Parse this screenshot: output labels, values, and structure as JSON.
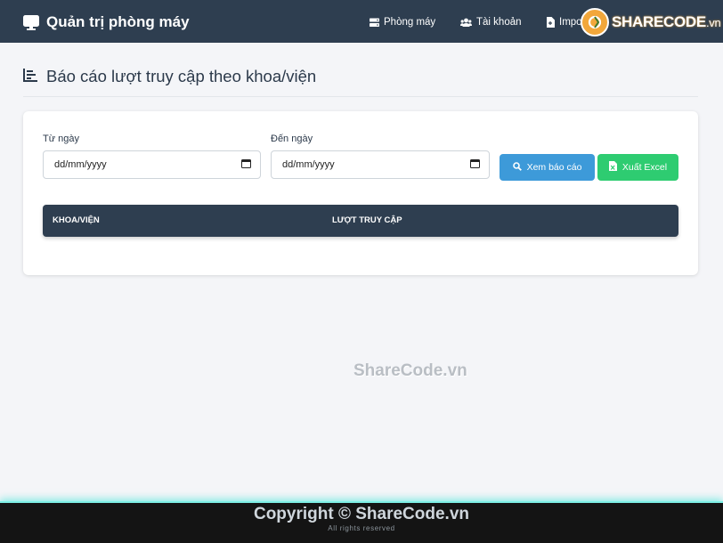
{
  "navbar": {
    "brand": "Quản trị phòng máy",
    "items": [
      {
        "label": "Phòng máy",
        "icon": "server-icon"
      },
      {
        "label": "Tài khoản",
        "icon": "users-icon"
      },
      {
        "label": "Impo",
        "icon": "file-import-icon"
      }
    ],
    "logo": {
      "main": "SHARECODE",
      "suffix": ".vn"
    }
  },
  "page": {
    "title": "Báo cáo lượt truy cập theo khoa/viện"
  },
  "filters": {
    "from_label": "Từ ngày",
    "from_value": "dd/mm/yyyy",
    "to_label": "Đến ngày",
    "to_value": "dd/mm/yyyy",
    "view_button": "Xem báo cáo",
    "export_button": "Xuất Excel"
  },
  "table": {
    "columns": [
      "KHOA/VIỆN",
      "LƯỢT TRUY CẬP"
    ],
    "rows": []
  },
  "watermark": "ShareCode.vn",
  "footer": {
    "copyright": "Copyright © ShareCode.vn",
    "rights": "All rights reserved"
  },
  "colors": {
    "navbar": "#2e3e50",
    "primary_button": "#3d9ad9",
    "success_button": "#2ecc71",
    "table_header": "#2e3e50"
  }
}
